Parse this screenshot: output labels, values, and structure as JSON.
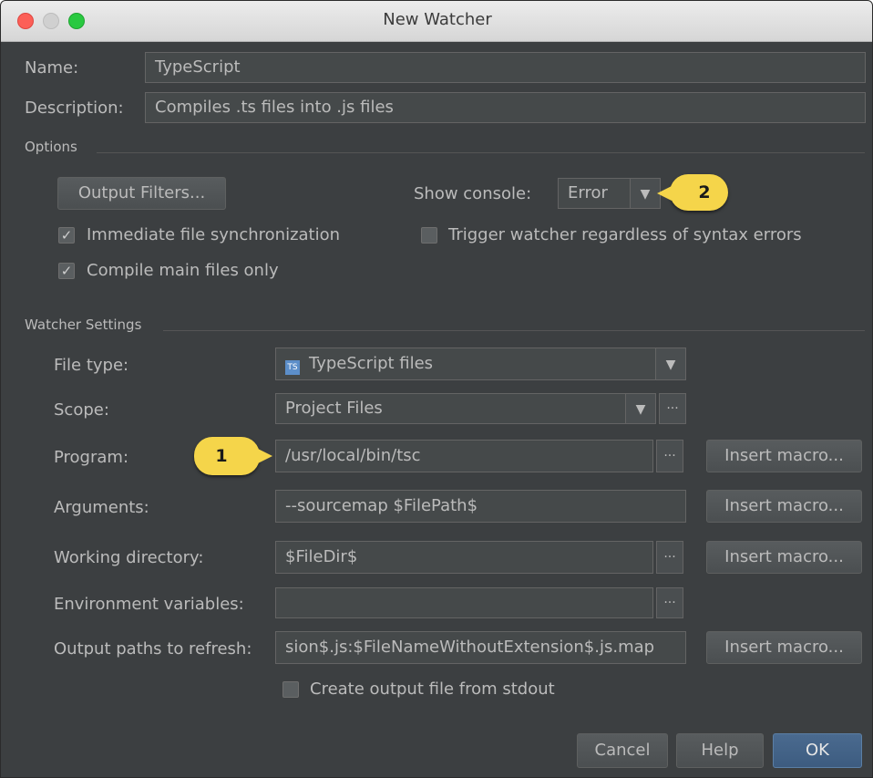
{
  "window": {
    "title": "New Watcher"
  },
  "name": {
    "label": "Name:",
    "value": "TypeScript"
  },
  "description": {
    "label": "Description:",
    "value": "Compiles .ts files into .js files"
  },
  "options": {
    "section_title": "Options",
    "output_filters_label": "Output Filters...",
    "show_console_label": "Show console:",
    "show_console_value": "Error",
    "immediate_sync_label": "Immediate file synchronization",
    "immediate_sync_checked": true,
    "trigger_label": "Trigger watcher regardless of syntax errors",
    "trigger_checked": false,
    "compile_main_label": "Compile main files only",
    "compile_main_checked": true
  },
  "watcher": {
    "section_title": "Watcher Settings",
    "file_type_label": "File type:",
    "file_type_value": "TypeScript files",
    "file_type_icon": "typescript-file-icon",
    "scope_label": "Scope:",
    "scope_value": "Project Files",
    "program_label": "Program:",
    "program_value": "/usr/local/bin/tsc",
    "arguments_label": "Arguments:",
    "arguments_value": "--sourcemap $FilePath$",
    "working_dir_label": "Working directory:",
    "working_dir_value": "$FileDir$",
    "env_label": "Environment variables:",
    "env_value": "",
    "output_paths_label": "Output paths to refresh:",
    "output_paths_value": "sion$.js:$FileNameWithoutExtension$.js.map",
    "insert_macro_label": "Insert macro...",
    "create_output_label": "Create output file from stdout",
    "create_output_checked": false
  },
  "buttons": {
    "cancel": "Cancel",
    "help": "Help",
    "ok": "OK"
  },
  "callouts": {
    "one": "1",
    "two": "2"
  },
  "colors": {
    "dialog_bg": "#3c3f41",
    "field_bg": "#45494a",
    "callout": "#f5d54a",
    "ok_button": "#3d5c80"
  }
}
